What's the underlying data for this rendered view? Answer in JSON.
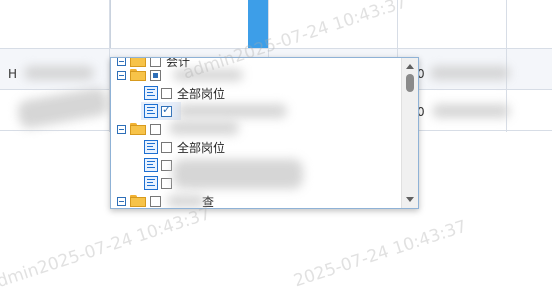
{
  "table": {
    "rows": [
      {
        "prefix": "H",
        "right_fragment": "0"
      },
      {
        "prefix": "",
        "right_fragment": "0"
      }
    ]
  },
  "tree": {
    "nodes": [
      {
        "type": "folder",
        "label": "会计",
        "check": "none"
      },
      {
        "type": "folder",
        "label": "",
        "check": "partial"
      },
      {
        "type": "item",
        "label": "全部岗位",
        "check": "none"
      },
      {
        "type": "item",
        "label": "",
        "check": "checked"
      },
      {
        "type": "folder",
        "label": "",
        "check": "none"
      },
      {
        "type": "item",
        "label": "全部岗位",
        "check": "none"
      },
      {
        "type": "item",
        "label": "",
        "check": "none"
      },
      {
        "type": "item",
        "label": "",
        "check": "none"
      },
      {
        "type": "folder",
        "label": "查",
        "check": "none"
      }
    ]
  },
  "watermark": {
    "texts": [
      "admin2025-07-24 10:43:37",
      "dmin2025-07-24 10:43:37",
      "2025-07-24 10:43:37"
    ]
  },
  "colors": {
    "accent": "#3d9ee8",
    "panel_border": "#8fb2d6",
    "folder": "#f7c349"
  }
}
